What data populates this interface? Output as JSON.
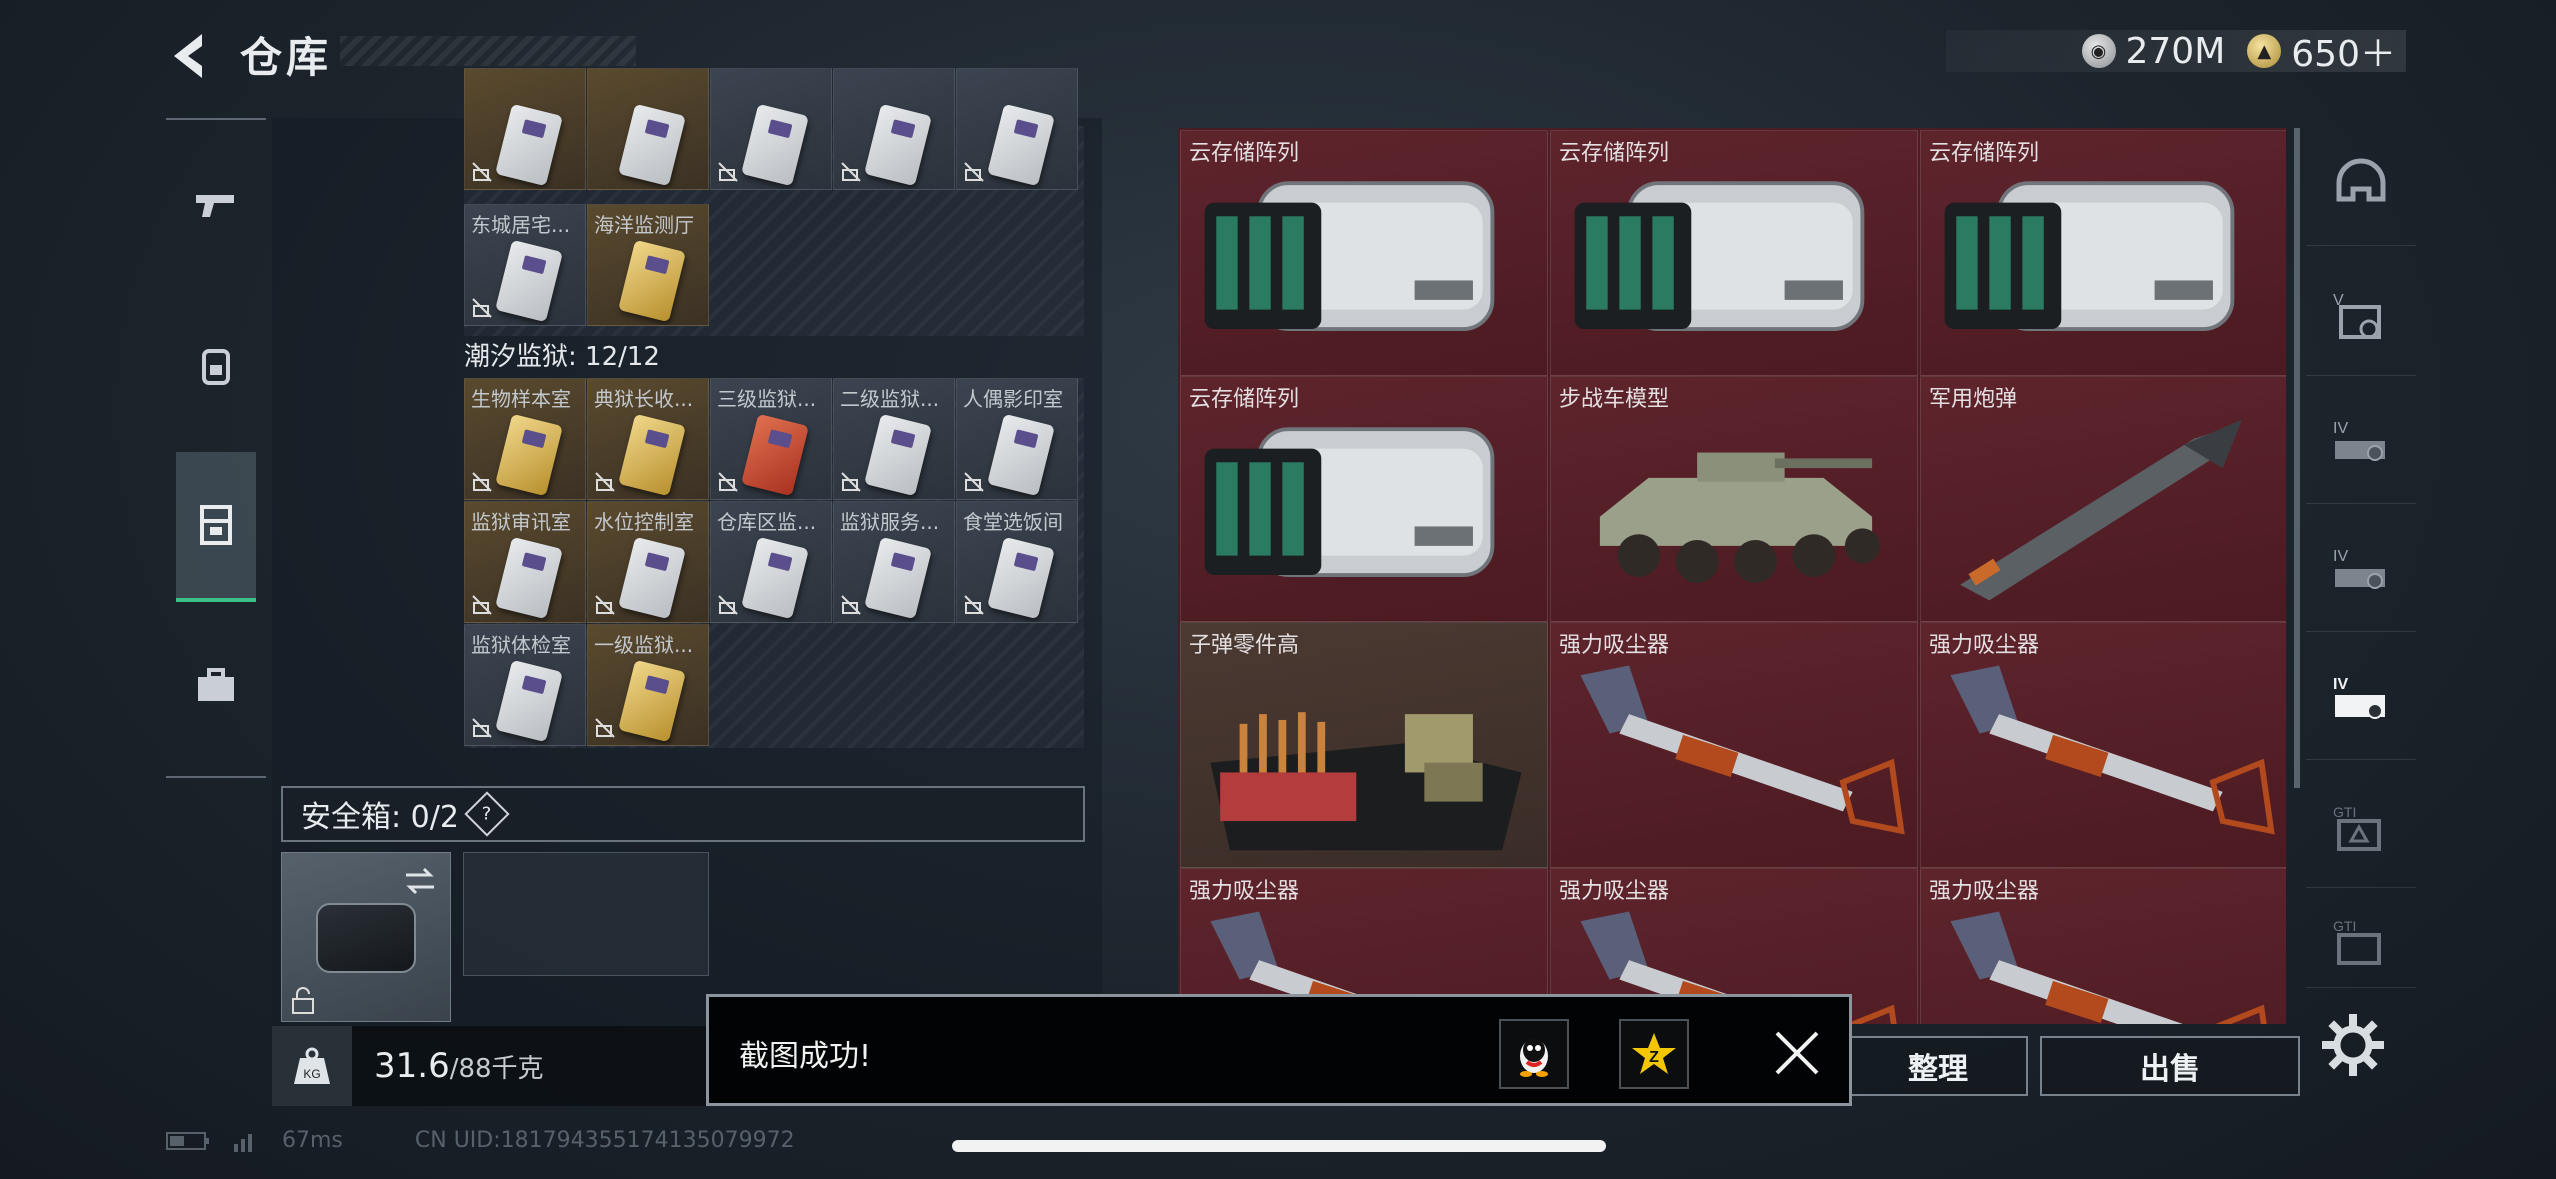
{
  "header": {
    "title": "仓库",
    "currency": [
      {
        "icon": "silver-coin-icon",
        "value": "270M"
      },
      {
        "icon": "gold-coin-icon",
        "value": "650＋"
      }
    ]
  },
  "left_nav": [
    {
      "name": "weapons",
      "icon": "pistol-icon"
    },
    {
      "name": "gear",
      "icon": "backpack-icon"
    },
    {
      "name": "storage",
      "icon": "locker-icon",
      "active": true
    },
    {
      "name": "briefcase",
      "icon": "briefcase-icon"
    }
  ],
  "keycard_section_top": {
    "row2_labels": [
      "东城居宅...",
      "海洋监测厅"
    ]
  },
  "section_prison": {
    "title": "潮汐监狱: 12/12",
    "items": [
      "生物样本室",
      "典狱长收...",
      "三级监狱...",
      "二级监狱...",
      "人偶影印室",
      "监狱审讯室",
      "水位控制室",
      "仓库区监...",
      "监狱服务...",
      "食堂选饭间",
      "监狱体检室",
      "一级监狱..."
    ]
  },
  "safebox": {
    "label": "安全箱: 0/2",
    "help": "?"
  },
  "weight": {
    "current": "31.6",
    "max": "/88千克",
    "icon_text": "KG"
  },
  "stash_items": [
    "云存储阵列",
    "云存储阵列",
    "云存储阵列",
    "云存储阵列",
    "步战车模型",
    "军用炮弹",
    "子弹零件高",
    "强力吸尘器",
    "强力吸尘器",
    "强力吸尘器",
    "强力吸尘器",
    "强力吸尘器"
  ],
  "right_nav": [
    {
      "icon": "helmet-icon"
    },
    {
      "icon": "vest-icon",
      "tier": "V"
    },
    {
      "icon": "rig-icon",
      "tier": "IV"
    },
    {
      "icon": "rig-icon",
      "tier": "IV"
    },
    {
      "icon": "backpack-tier-icon",
      "tier": "IV"
    },
    {
      "icon": "gti-icon",
      "tier": "GTI"
    },
    {
      "icon": "gti-icon",
      "tier": "GTI"
    }
  ],
  "buttons": {
    "sort": "整理",
    "sell": "出售"
  },
  "toast": {
    "text": "截图成功!"
  },
  "status": {
    "ping": "67ms",
    "uid": "CN UID:1817943551741350799​72"
  },
  "colors": {
    "accent_green": "#3cc08a",
    "item_red": "#5e242c",
    "gold_card": "#5a4a2e"
  }
}
